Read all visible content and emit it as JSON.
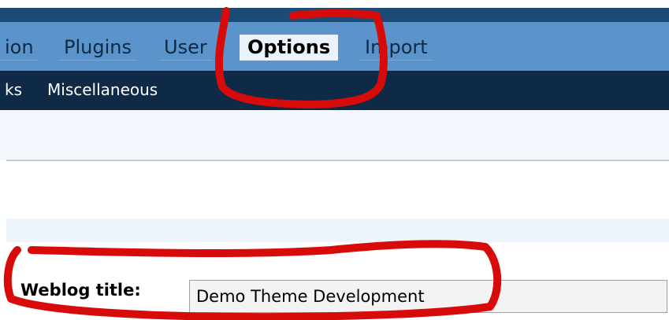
{
  "nav": {
    "tabs": [
      {
        "label": "ion"
      },
      {
        "label": "Plugins"
      },
      {
        "label": "User"
      },
      {
        "label": "Options"
      },
      {
        "label": "Import"
      }
    ]
  },
  "subnav": {
    "items": [
      {
        "label": "ks"
      },
      {
        "label": "Miscellaneous"
      }
    ]
  },
  "form": {
    "weblog_title_label": "Weblog title:",
    "weblog_title_value": "Demo Theme Development"
  },
  "colors": {
    "primary_nav": "#5b93cb",
    "sub_nav": "#0f2a47",
    "active_tab": "#eaf2fb",
    "annotation_red": "#d80b0b"
  }
}
